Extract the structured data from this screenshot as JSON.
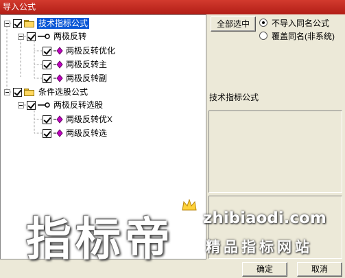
{
  "window": {
    "title": "导入公式"
  },
  "tree": {
    "groups": [
      {
        "label": "技术指标公式",
        "checked": true,
        "selected": true,
        "sub": {
          "label": "两极反转",
          "checked": true,
          "items": [
            {
              "label": "两极反转优化",
              "checked": true
            },
            {
              "label": "两极反转主",
              "checked": true
            },
            {
              "label": "两极反转副",
              "checked": true
            }
          ]
        }
      },
      {
        "label": "条件选股公式",
        "checked": true,
        "selected": false,
        "sub": {
          "label": "两极反转选股",
          "checked": true,
          "items": [
            {
              "label": "两级反转优X",
              "checked": true
            },
            {
              "label": "两级反转选",
              "checked": true
            }
          ]
        }
      }
    ]
  },
  "options": {
    "select_all_label": "全部选中",
    "radios": [
      {
        "label": "不导入同名公式",
        "selected": true
      },
      {
        "label": "覆盖同名(非系统)",
        "selected": false
      }
    ]
  },
  "info": {
    "formula_type": "技术指标公式"
  },
  "footer": {
    "ok_label": "确定",
    "cancel_label": "取消"
  },
  "watermark": {
    "main": "指标帝",
    "url": "zhibiaodi.com",
    "sub": "精品指标网站"
  },
  "colors": {
    "title_bar": "#c42b20",
    "selection": "#0a57d6",
    "diamond": "#c000c0"
  }
}
